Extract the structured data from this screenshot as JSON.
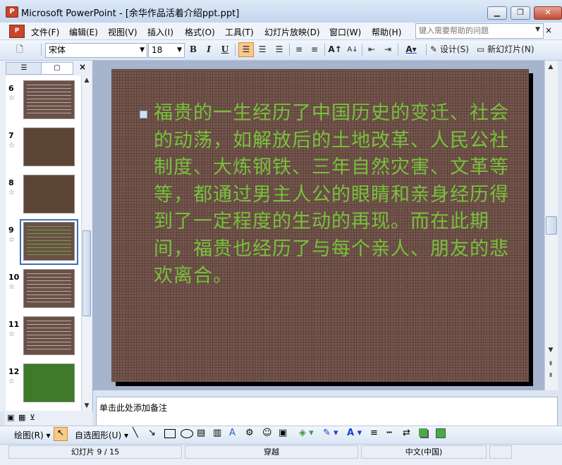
{
  "window": {
    "title": "Microsoft PowerPoint - [余华作品活着介绍ppt.ppt]",
    "app_icon_letter": "P",
    "controls": [
      "minimize",
      "restore",
      "close"
    ]
  },
  "menu": {
    "items": [
      "文件(F)",
      "编辑(E)",
      "视图(V)",
      "插入(I)",
      "格式(O)",
      "工具(T)",
      "幻灯片放映(D)",
      "窗口(W)",
      "帮助(H)"
    ],
    "help_placeholder": "键入需要帮助的问题"
  },
  "toolbar": {
    "font_name": "宋体",
    "font_size": "18",
    "bold": "B",
    "italic": "I",
    "underline": "U",
    "design_label": "设计(S)",
    "new_slide_label": "新幻灯片(N)"
  },
  "panel": {
    "tabs": [
      "outline",
      "slides"
    ],
    "thumbnails": [
      {
        "num": "6",
        "style": "brown-text"
      },
      {
        "num": "7",
        "style": "photo"
      },
      {
        "num": "8",
        "style": "photo"
      },
      {
        "num": "9",
        "style": "brown-text",
        "selected": true
      },
      {
        "num": "10",
        "style": "brown-text"
      },
      {
        "num": "11",
        "style": "brown-text"
      },
      {
        "num": "12",
        "style": "green-photo"
      }
    ]
  },
  "slide": {
    "body_text": "福贵的一生经历了中国历史的变迁、社会的动荡，如解放后的土地改革、人民公社制度、大炼钢铁、三年自然灾害、文革等等，都通过男主人公的眼睛和亲身经历得到了一定程度的生动的再现。而在此期间，福贵也经历了与每个亲人、朋友的悲欢离合。",
    "text_color": "#77c13b",
    "background": "brown-texture"
  },
  "notes": {
    "placeholder": "单击此处添加备注"
  },
  "drawbar": {
    "draw_label": "绘图(R)",
    "autoshapes_label": "自选图形(U)"
  },
  "status": {
    "slide_counter": "幻灯片 9 / 15",
    "design_name": "穿越",
    "language": "中文(中国)"
  }
}
